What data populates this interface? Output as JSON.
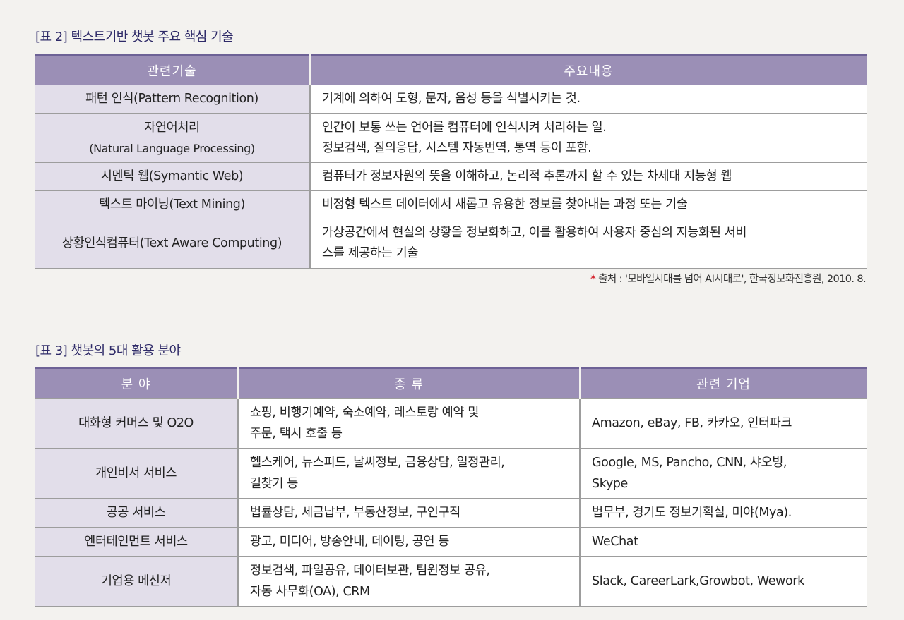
{
  "table2": {
    "caption_label": "[표 2]",
    "caption_title": "텍스트기반 챗봇 주요 핵심 기술",
    "headers": [
      "관련기술",
      "주요내용"
    ],
    "rows": [
      {
        "tech": "패턴 인식(Pattern Recognition)",
        "tech_sub": "",
        "content": [
          "기계에 의하여 도형, 문자, 음성 등을 식별시키는 것."
        ]
      },
      {
        "tech": "자연어처리",
        "tech_sub": "(Natural Language Processing)",
        "content": [
          "인간이 보통 쓰는 언어를 컴퓨터에 인식시켜 처리하는 일.",
          "정보검색, 질의응답, 시스템 자동번역, 통역 등이 포함."
        ]
      },
      {
        "tech": "시멘틱 웹(Symantic Web)",
        "tech_sub": "",
        "content": [
          "컴퓨터가 정보자원의 뜻을 이해하고, 논리적 추론까지 할 수 있는 차세대 지능형 웹"
        ]
      },
      {
        "tech": "텍스트 마이닝(Text Mining)",
        "tech_sub": "",
        "content": [
          "비정형 텍스트 데이터에서 새롭고 유용한 정보를 찾아내는 과정 또는 기술"
        ]
      },
      {
        "tech": "상황인식컴퓨터(Text Aware Computing)",
        "tech_sub": "",
        "content": [
          "가상공간에서 현실의 상황을 정보화하고, 이를 활용하여 사용자 중심의 지능화된 서비",
          "스를 제공하는 기술"
        ]
      }
    ],
    "source_star": "*",
    "source_text": "출처 : '모바일시대를 넘어 AI시대로', 한국정보화진흥원, 2010. 8."
  },
  "table3": {
    "caption_label": "[표 3]",
    "caption_title": "챗봇의 5대 활용 분야",
    "headers": [
      "분 야",
      "종 류",
      "관련 기업"
    ],
    "rows": [
      {
        "field": "대화형 커머스 및 O2O",
        "kinds": [
          "쇼핑, 비행기예약, 숙소예약, 레스토랑 예약 및",
          "주문, 택시 호출 등"
        ],
        "companies": [
          "Amazon, eBay, FB, 카카오, 인터파크"
        ]
      },
      {
        "field": "개인비서 서비스",
        "kinds": [
          "헬스케어, 뉴스피드, 날씨정보, 금융상담, 일정관리,",
          "길찾기 등"
        ],
        "companies": [
          "Google, MS, Pancho, CNN, 샤오빙,",
          "Skype"
        ]
      },
      {
        "field": "공공 서비스",
        "kinds": [
          "법률상담, 세금납부, 부동산정보, 구인구직"
        ],
        "companies": [
          "법무부, 경기도 정보기획실, 미야(Mya)."
        ]
      },
      {
        "field": "엔터테인먼트 서비스",
        "kinds": [
          "광고, 미디어, 방송안내, 데이팅, 공연 등"
        ],
        "companies": [
          "WeChat"
        ]
      },
      {
        "field": "기업용 메신저",
        "kinds": [
          "정보검색, 파일공유, 데이터보관, 팀원정보 공유,",
          "자동 사무화(OA), CRM"
        ],
        "companies": [
          "Slack, CareerLark,Growbot, Wework"
        ]
      }
    ]
  }
}
